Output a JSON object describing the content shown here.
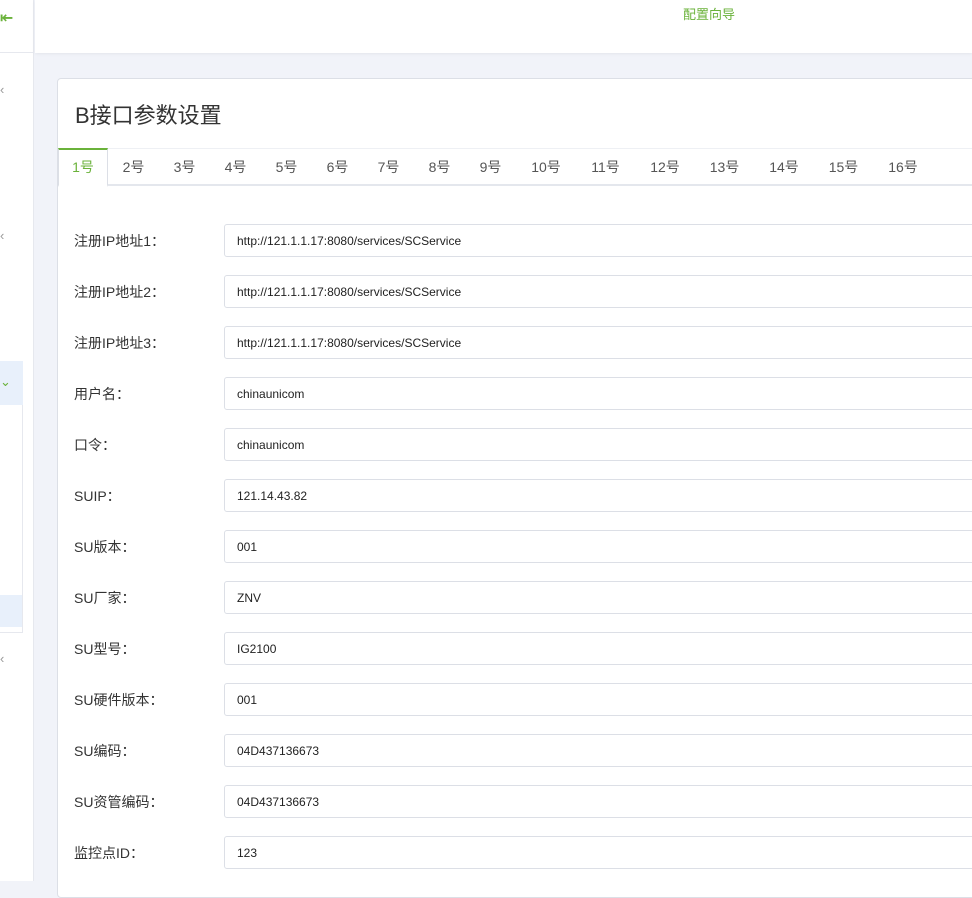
{
  "sidebar": {
    "collapse_icon": "collapse-left-icon",
    "chevrons": [
      "chevron-left-icon",
      "chevron-left-icon",
      "chevron-left-icon"
    ],
    "open_group_icon": "chevron-down-icon"
  },
  "topbar": {
    "wizard_link": "配置向导"
  },
  "panel": {
    "title": "B接口参数设置"
  },
  "tabs": [
    "1号",
    "2号",
    "3号",
    "4号",
    "5号",
    "6号",
    "7号",
    "8号",
    "9号",
    "10号",
    "11号",
    "12号",
    "13号",
    "14号",
    "15号",
    "16号"
  ],
  "active_tab": "1号",
  "form": {
    "fields": [
      {
        "label": "注册IP地址1：",
        "value": "http://121.1.1.17:8080/services/SCService"
      },
      {
        "label": "注册IP地址2：",
        "value": "http://121.1.1.17:8080/services/SCService"
      },
      {
        "label": "注册IP地址3：",
        "value": "http://121.1.1.17:8080/services/SCService"
      },
      {
        "label": "用户名：",
        "value": "chinaunicom"
      },
      {
        "label": "口令：",
        "value": "chinaunicom"
      },
      {
        "label": "SUIP：",
        "value": "121.14.43.82"
      },
      {
        "label": "SU版本：",
        "value": "001"
      },
      {
        "label": "SU厂家：",
        "value": "ZNV"
      },
      {
        "label": "SU型号：",
        "value": "IG2100"
      },
      {
        "label": "SU硬件版本：",
        "value": "001"
      },
      {
        "label": "SU编码：",
        "value": "04D437136673"
      },
      {
        "label": "SU资管编码：",
        "value": "04D437136673"
      },
      {
        "label": "监控点ID：",
        "value": "123"
      }
    ]
  },
  "colors": {
    "accent": "#6ab23a",
    "background": "#f1f3f9",
    "border": "#dcdfe6"
  }
}
